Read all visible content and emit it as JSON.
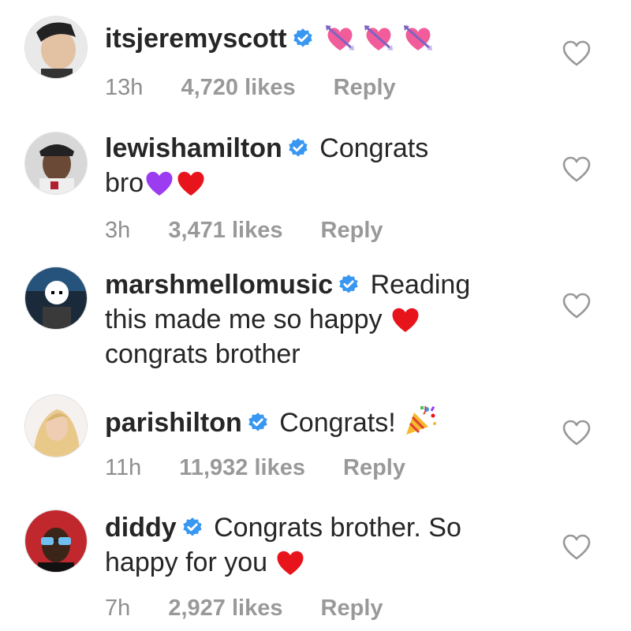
{
  "comments": [
    {
      "username": "itsjeremyscott",
      "text": "",
      "emojis": [
        "heart-with-arrow",
        "heart-with-arrow",
        "heart-with-arrow"
      ],
      "time": "13h",
      "likes": "4,720 likes",
      "reply": "Reply",
      "verified": true
    },
    {
      "username": "lewishamilton",
      "text_line1": "Congrats",
      "text_line2": "bro",
      "emojis": [
        "purple-heart",
        "red-heart"
      ],
      "time": "3h",
      "likes": "3,471 likes",
      "reply": "Reply",
      "verified": true
    },
    {
      "username": "marshmellomusic",
      "text_line1": "Reading",
      "text_line2": "this made me so happy",
      "text_line3": "congrats brother",
      "emojis": [
        "red-heart"
      ],
      "verified": true
    },
    {
      "username": "parishilton",
      "text": "Congrats!",
      "emojis": [
        "party-popper"
      ],
      "time": "11h",
      "likes": "11,932 likes",
      "reply": "Reply",
      "verified": true
    },
    {
      "username": "diddy",
      "text_line1": "Congrats brother. So",
      "text_line2": "happy for you",
      "emojis": [
        "red-heart"
      ],
      "time": "7h",
      "likes": "2,927 likes",
      "reply": "Reply",
      "verified": true
    }
  ],
  "colors": {
    "verified_badge": "#3897f0",
    "meta_text": "#8e8e8e",
    "body_text": "#262626",
    "like_icon_stroke": "#999999"
  }
}
